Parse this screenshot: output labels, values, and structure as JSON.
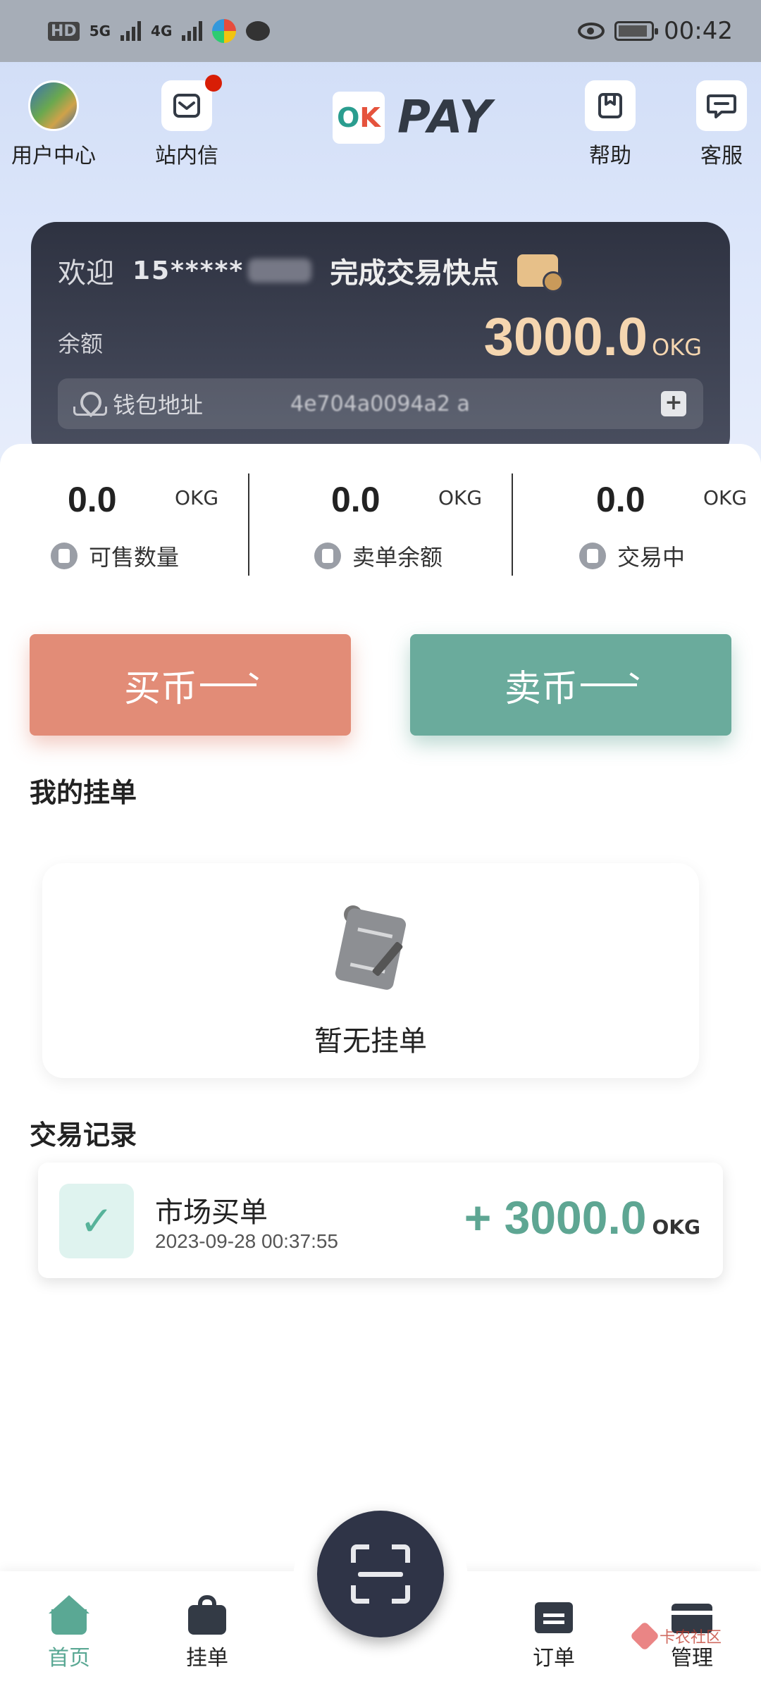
{
  "status_bar": {
    "hd": "HD",
    "net1": "5G",
    "net2": "4G",
    "time": "00:42"
  },
  "header": {
    "user_center": "用户中心",
    "inbox": "站内信",
    "logo_text": "PAY",
    "logo_mark_left": "O",
    "logo_mark_right": "K",
    "help": "帮助",
    "service": "客服"
  },
  "wallet": {
    "welcome": "欢迎",
    "phone_masked": "15*****",
    "quick_trade": "完成交易快点",
    "balance_label": "余额",
    "balance": "3000.0",
    "unit": "OKG",
    "address_label": "钱包地址",
    "address_value": "4e704a0094a2   a"
  },
  "stats": [
    {
      "value": "0.0",
      "unit": "OKG",
      "label": "可售数量"
    },
    {
      "value": "0.0",
      "unit": "OKG",
      "label": "卖单余额"
    },
    {
      "value": "0.0",
      "unit": "OKG",
      "label": "交易中"
    }
  ],
  "actions": {
    "buy": "买币",
    "sell": "卖币"
  },
  "my_orders": {
    "title": "我的挂单",
    "empty_text": "暂无挂单"
  },
  "records": {
    "title": "交易记录",
    "items": [
      {
        "title": "市场买单",
        "time": "2023-09-28 00:37:55",
        "amount": "+ 3000.0",
        "unit": "OKG",
        "icon": "check-icon"
      }
    ]
  },
  "bottom_nav": {
    "home": "首页",
    "orders_listed": "挂单",
    "orders": "订单",
    "manage": "管理"
  },
  "watermark": {
    "text": "卡农社区"
  },
  "colors": {
    "buy": "#e28c77",
    "sell": "#6aab9c",
    "accent": "#5aa894",
    "card_dark": "#2e3241",
    "balance_gold": "#f5d6b0"
  }
}
